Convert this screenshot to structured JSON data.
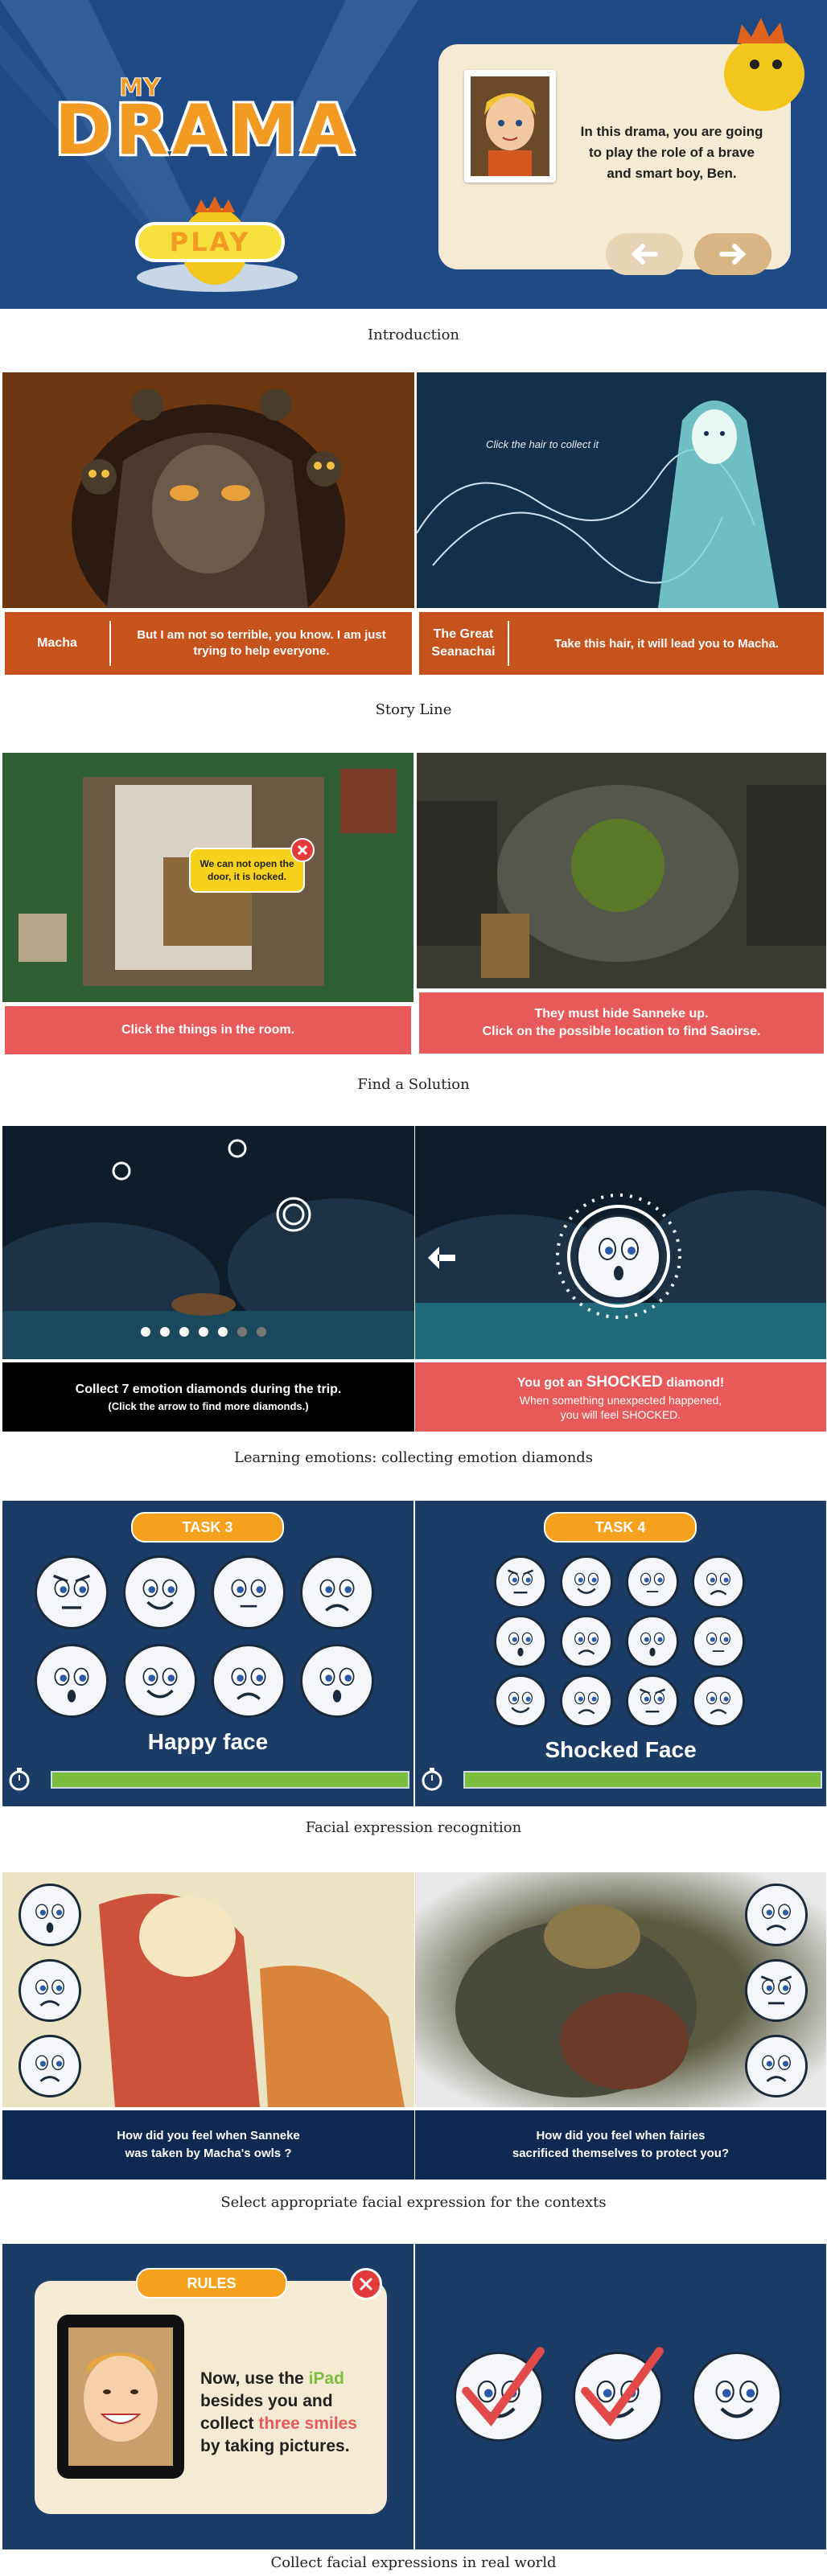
{
  "captions": {
    "intro": "Introduction",
    "story": "Story Line",
    "solution": "Find a Solution",
    "emotions": "Learning emotions: collecting emotion diamonds",
    "recognition": "Facial expression recognition",
    "contexts": "Select appropriate facial expression for the contexts",
    "realworld": "Collect facial expressions in real world"
  },
  "intro": {
    "logo_my": "MY",
    "logo_drama": "DRAMA",
    "play_label": "PLAY",
    "dialog_text": "In this drama, you are going to play the role of a brave and smart boy, Ben."
  },
  "story": {
    "left_speaker": "Macha",
    "left_line": "But I am not so terrible, you know. I am just trying to help everyone.",
    "right_speaker": "The Great Seanachai",
    "right_line": "Take this hair, it will lead you to Macha.",
    "hint": "Click the hair to collect it"
  },
  "solution": {
    "bubble": "We can not open the door, it is locked.",
    "left_bar": "Click the things in the room.",
    "right_bar_1": "They must hide Sanneke up.",
    "right_bar_2": "Click on the possible location to find Saoirse."
  },
  "emotions": {
    "left_main": "Collect 7 emotion diamonds during the trip.",
    "left_sub": "(Click the arrow to find more diamonds.)",
    "right_main_prefix": "You got an ",
    "right_main_strong": "SHOCKED",
    "right_main_suffix": " diamond!",
    "right_sub_1": "When something unexpected happened,",
    "right_sub_2": "you will feel SHOCKED."
  },
  "recognition": {
    "task_left": "TASK 3",
    "task_right": "TASK 4",
    "label_left": "Happy face",
    "label_right": "Shocked Face"
  },
  "contexts": {
    "left_q_1": "How did you feel when Sanneke",
    "left_q_2": "was taken by Macha's owls ?",
    "right_q_1": "How did you feel when fairies",
    "right_q_2": "sacrificed themselves to protect you?"
  },
  "realworld": {
    "rules": "RULES",
    "line1_a": "Now, use the ",
    "line1_b": "iPad",
    "line2": "besides you and",
    "line3_a": "collect ",
    "line3_b": "three smiles",
    "line4": "by taking pictures."
  },
  "colors": {
    "navy": "#1f4a85",
    "orange_bar": "#c6521c",
    "coral": "#e85a5a",
    "dark_navy": "#0f2a52",
    "green": "#7cbd3d"
  }
}
